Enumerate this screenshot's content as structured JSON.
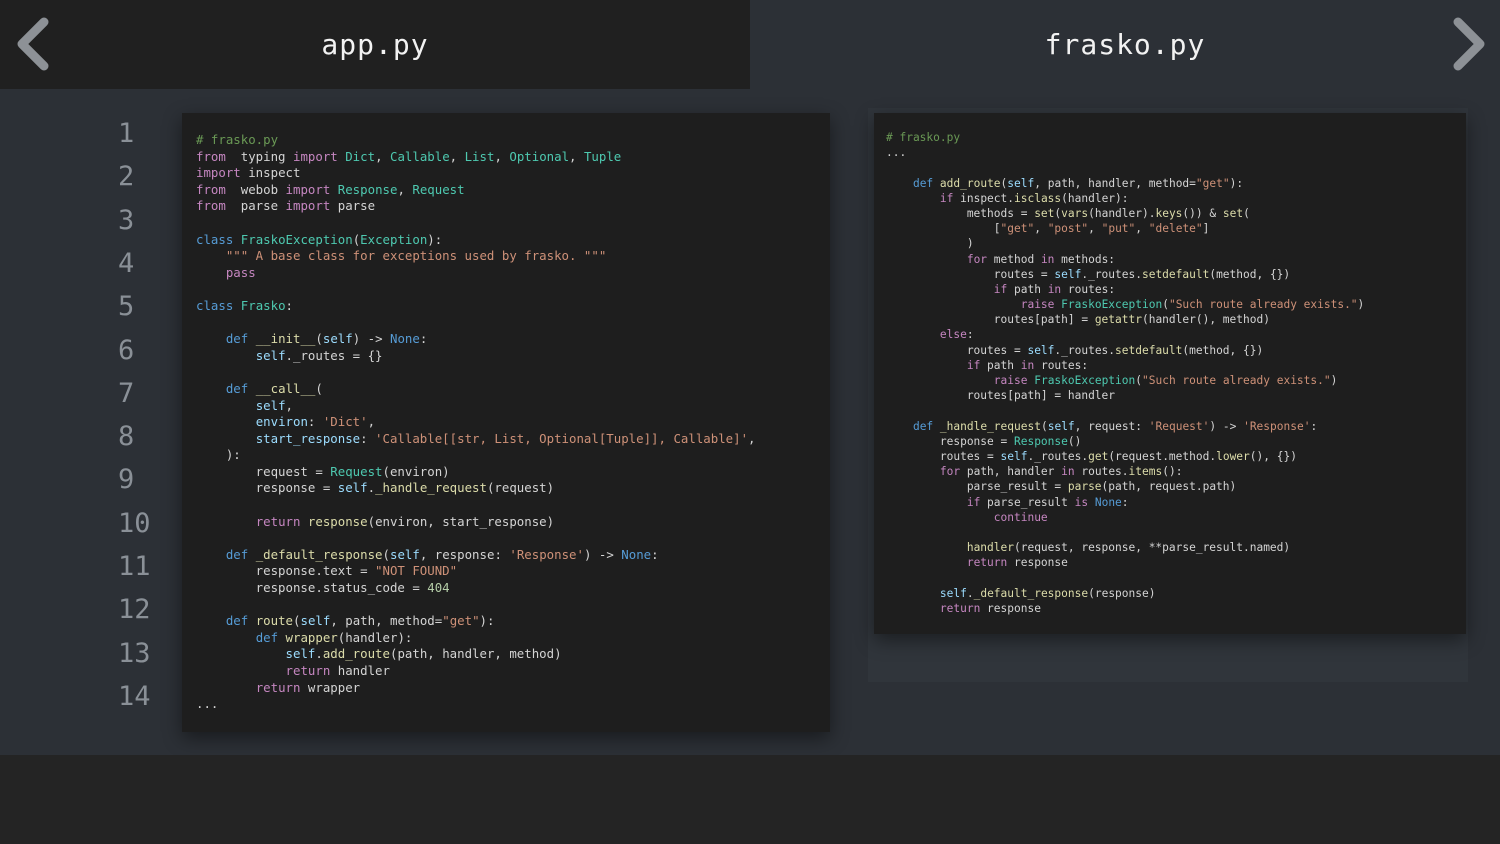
{
  "tabs": {
    "left": "app.py",
    "right": "frasko.py"
  },
  "nav": {
    "prev_icon": "chevron-left-icon",
    "next_icon": "chevron-right-icon"
  },
  "colors": {
    "chevron": "#8d9196",
    "editor_bg": "#1e1e1e",
    "page_bg": "#2c3036"
  },
  "line_numbers": [
    "1",
    "2",
    "3",
    "4",
    "5",
    "6",
    "7",
    "8",
    "9",
    "10",
    "11",
    "12",
    "13",
    "14"
  ],
  "code_left": [
    [
      [
        "c",
        "# frasko.py"
      ]
    ],
    [
      [
        "k",
        "from"
      ],
      [
        "",
        "  typing "
      ],
      [
        "k",
        "import"
      ],
      [
        "",
        "",
        " "
      ],
      [
        "t",
        "Dict"
      ],
      [
        "",
        ", "
      ],
      [
        "t",
        "Callable"
      ],
      [
        "",
        ", "
      ],
      [
        "t",
        "List"
      ],
      [
        "",
        ", "
      ],
      [
        "t",
        "Optional"
      ],
      [
        "",
        ", "
      ],
      [
        "t",
        "Tuple"
      ]
    ],
    [
      [
        "k",
        "import"
      ],
      [
        "",
        "",
        " inspect"
      ]
    ],
    [
      [
        "k",
        "from"
      ],
      [
        "",
        "  webob "
      ],
      [
        "k",
        "import"
      ],
      [
        "",
        "",
        " "
      ],
      [
        "t",
        "Response"
      ],
      [
        "",
        ", "
      ],
      [
        "t",
        "Request"
      ]
    ],
    [
      [
        "k",
        "from"
      ],
      [
        "",
        "  parse "
      ],
      [
        "k",
        "import"
      ],
      [
        "",
        "",
        " parse"
      ]
    ],
    [],
    [
      [
        "b",
        "class"
      ],
      [
        "",
        " "
      ],
      [
        "t",
        "FraskoException"
      ],
      [
        "",
        "("
      ],
      [
        "t",
        "Exception"
      ],
      [
        "",
        "):"
      ]
    ],
    [
      [
        "",
        ""
      ],
      [
        "",
        "    "
      ],
      [
        "s",
        "\"\"\" A base class for exceptions used by frasko. \"\"\""
      ]
    ],
    [
      [
        "",
        "    "
      ],
      [
        "k",
        "pass"
      ]
    ],
    [],
    [
      [
        "b",
        "class"
      ],
      [
        "",
        " "
      ],
      [
        "t",
        "Frasko"
      ],
      [
        "",
        ":"
      ]
    ],
    [],
    [
      [
        "",
        "    "
      ],
      [
        "b",
        "def"
      ],
      [
        "",
        " "
      ],
      [
        "f",
        "__init__"
      ],
      [
        "",
        "("
      ],
      [
        "v",
        "self"
      ],
      [
        "",
        ") -> "
      ],
      [
        "b",
        "None"
      ],
      [
        "",
        ":"
      ]
    ],
    [
      [
        "",
        "        "
      ],
      [
        "v",
        "self"
      ],
      [
        "",
        "._routes = {}"
      ]
    ],
    [],
    [
      [
        "",
        "    "
      ],
      [
        "b",
        "def"
      ],
      [
        "",
        " "
      ],
      [
        "f",
        "__call__"
      ],
      [
        "",
        "("
      ]
    ],
    [
      [
        "",
        "        "
      ],
      [
        "v",
        "self"
      ],
      [
        "",
        ","
      ]
    ],
    [
      [
        "",
        "        "
      ],
      [
        "v",
        "environ"
      ],
      [
        "",
        ": "
      ],
      [
        "s",
        "'Dict'"
      ],
      [
        "",
        ","
      ]
    ],
    [
      [
        "",
        "        "
      ],
      [
        "v",
        "start_response"
      ],
      [
        "",
        ": "
      ],
      [
        "s",
        "'Callable[[str, List, Optional[Tuple]], Callable]'"
      ],
      [
        "",
        ","
      ]
    ],
    [
      [
        "",
        "    ):"
      ]
    ],
    [
      [
        "",
        "        request = "
      ],
      [
        "t",
        "Request"
      ],
      [
        "",
        "(environ)"
      ]
    ],
    [
      [
        "",
        "        response = "
      ],
      [
        "v",
        "self"
      ],
      [
        "",
        "."
      ],
      [
        "f",
        "_handle_request"
      ],
      [
        "",
        "(request)"
      ]
    ],
    [],
    [
      [
        "",
        "        "
      ],
      [
        "k",
        "return"
      ],
      [
        "",
        " "
      ],
      [
        "f",
        "response"
      ],
      [
        "",
        "(environ, start_response)"
      ]
    ],
    [],
    [
      [
        "",
        "    "
      ],
      [
        "b",
        "def"
      ],
      [
        "",
        " "
      ],
      [
        "f",
        "_default_response"
      ],
      [
        "",
        "("
      ],
      [
        "v",
        "self"
      ],
      [
        "",
        ", response: "
      ],
      [
        "s",
        "'Response'"
      ],
      [
        "",
        ") -> "
      ],
      [
        "b",
        "None"
      ],
      [
        "",
        ":"
      ]
    ],
    [
      [
        "",
        "        response.text = "
      ],
      [
        "s",
        "\"NOT FOUND\""
      ]
    ],
    [
      [
        "",
        "        response.status_code = "
      ],
      [
        "n",
        "404"
      ]
    ],
    [],
    [
      [
        "",
        "    "
      ],
      [
        "b",
        "def"
      ],
      [
        "",
        " "
      ],
      [
        "f",
        "route"
      ],
      [
        "",
        "("
      ],
      [
        "v",
        "self"
      ],
      [
        "",
        ", path, method="
      ],
      [
        "s",
        "\"get\""
      ],
      [
        "",
        "):"
      ]
    ],
    [
      [
        "",
        "        "
      ],
      [
        "b",
        "def"
      ],
      [
        "",
        " "
      ],
      [
        "f",
        "wrapper"
      ],
      [
        "",
        "(handler):"
      ]
    ],
    [
      [
        "",
        "            "
      ],
      [
        "v",
        "self"
      ],
      [
        "",
        "."
      ],
      [
        "f",
        "add_route"
      ],
      [
        "",
        "(path, handler, method)"
      ]
    ],
    [
      [
        "",
        "            "
      ],
      [
        "k",
        "return"
      ],
      [
        "",
        " handler"
      ]
    ],
    [
      [
        "",
        "        "
      ],
      [
        "k",
        "return"
      ],
      [
        "",
        " wrapper"
      ]
    ],
    [
      [
        "",
        "..."
      ]
    ]
  ],
  "code_right": [
    [
      [
        "c",
        "# frasko.py"
      ]
    ],
    [
      [
        "",
        "..."
      ]
    ],
    [],
    [
      [
        "",
        "    "
      ],
      [
        "b",
        "def"
      ],
      [
        "",
        " "
      ],
      [
        "f",
        "add_route"
      ],
      [
        "",
        "("
      ],
      [
        "v",
        "self"
      ],
      [
        "",
        ", path, handler, method="
      ],
      [
        "s",
        "\"get\""
      ],
      [
        "",
        "):"
      ]
    ],
    [
      [
        "",
        "        "
      ],
      [
        "k",
        "if"
      ],
      [
        "",
        " inspect."
      ],
      [
        "f",
        "isclass"
      ],
      [
        "",
        "(handler):"
      ]
    ],
    [
      [
        "",
        "            methods = "
      ],
      [
        "f",
        "set"
      ],
      [
        "",
        "("
      ],
      [
        "f",
        "vars"
      ],
      [
        "",
        "(handler)."
      ],
      [
        "f",
        "keys"
      ],
      [
        "",
        "()) & "
      ],
      [
        "f",
        "set"
      ],
      [
        "",
        "("
      ]
    ],
    [
      [
        "",
        "                ["
      ],
      [
        "s",
        "\"get\""
      ],
      [
        "",
        ", "
      ],
      [
        "s",
        "\"post\""
      ],
      [
        "",
        ", "
      ],
      [
        "s",
        "\"put\""
      ],
      [
        "",
        ", "
      ],
      [
        "s",
        "\"delete\""
      ],
      [
        "",
        "]"
      ]
    ],
    [
      [
        "",
        "            )"
      ]
    ],
    [
      [
        "",
        "            "
      ],
      [
        "k",
        "for"
      ],
      [
        "",
        " method "
      ],
      [
        "k",
        "in"
      ],
      [
        "",
        " methods:"
      ]
    ],
    [
      [
        "",
        "                routes = "
      ],
      [
        "v",
        "self"
      ],
      [
        "",
        "._routes."
      ],
      [
        "f",
        "setdefault"
      ],
      [
        "",
        "(method, {})"
      ]
    ],
    [
      [
        "",
        "                "
      ],
      [
        "k",
        "if"
      ],
      [
        "",
        " path "
      ],
      [
        "k",
        "in"
      ],
      [
        "",
        " routes:"
      ]
    ],
    [
      [
        "",
        "                    "
      ],
      [
        "k",
        "raise"
      ],
      [
        "",
        " "
      ],
      [
        "t",
        "FraskoException"
      ],
      [
        "",
        "("
      ],
      [
        "s",
        "\"Such route already exists.\""
      ],
      [
        "",
        ")"
      ]
    ],
    [
      [
        "",
        "                routes[path] = "
      ],
      [
        "f",
        "getattr"
      ],
      [
        "",
        "(handler(), method)"
      ]
    ],
    [
      [
        "",
        "        "
      ],
      [
        "k",
        "else"
      ],
      [
        "",
        ":"
      ]
    ],
    [
      [
        "",
        "            routes = "
      ],
      [
        "v",
        "self"
      ],
      [
        "",
        "._routes."
      ],
      [
        "f",
        "setdefault"
      ],
      [
        "",
        "(method, {})"
      ]
    ],
    [
      [
        "",
        "            "
      ],
      [
        "k",
        "if"
      ],
      [
        "",
        " path "
      ],
      [
        "k",
        "in"
      ],
      [
        "",
        " routes:"
      ]
    ],
    [
      [
        "",
        "                "
      ],
      [
        "k",
        "raise"
      ],
      [
        "",
        " "
      ],
      [
        "t",
        "FraskoException"
      ],
      [
        "",
        "("
      ],
      [
        "s",
        "\"Such route already exists.\""
      ],
      [
        "",
        ")"
      ]
    ],
    [
      [
        "",
        "            routes[path] = handler"
      ]
    ],
    [],
    [
      [
        "",
        "    "
      ],
      [
        "b",
        "def"
      ],
      [
        "",
        " "
      ],
      [
        "f",
        "_handle_request"
      ],
      [
        "",
        "("
      ],
      [
        "v",
        "self"
      ],
      [
        "",
        ", request: "
      ],
      [
        "s",
        "'Request'"
      ],
      [
        "",
        ") -> "
      ],
      [
        "s",
        "'Response'"
      ],
      [
        "",
        ":"
      ]
    ],
    [
      [
        "",
        "        response = "
      ],
      [
        "t",
        "Response"
      ],
      [
        "",
        "()"
      ]
    ],
    [
      [
        "",
        "        routes = "
      ],
      [
        "v",
        "self"
      ],
      [
        "",
        "._routes."
      ],
      [
        "f",
        "get"
      ],
      [
        "",
        "(request.method."
      ],
      [
        "f",
        "lower"
      ],
      [
        "",
        "(), {})"
      ]
    ],
    [
      [
        "",
        "        "
      ],
      [
        "k",
        "for"
      ],
      [
        "",
        " path, handler "
      ],
      [
        "k",
        "in"
      ],
      [
        "",
        " routes."
      ],
      [
        "f",
        "items"
      ],
      [
        "",
        "():"
      ]
    ],
    [
      [
        "",
        "            parse_result = "
      ],
      [
        "f",
        "parse"
      ],
      [
        "",
        "(path, request.path)"
      ]
    ],
    [
      [
        "",
        "            "
      ],
      [
        "k",
        "if"
      ],
      [
        "",
        " parse_result "
      ],
      [
        "k",
        "is"
      ],
      [
        "",
        " "
      ],
      [
        "b",
        "None"
      ],
      [
        "",
        ":"
      ]
    ],
    [
      [
        "",
        "                "
      ],
      [
        "k",
        "continue"
      ]
    ],
    [],
    [
      [
        "",
        "            "
      ],
      [
        "f",
        "handler"
      ],
      [
        "",
        "(request, response, **parse_result.named)"
      ]
    ],
    [
      [
        "",
        "            "
      ],
      [
        "k",
        "return"
      ],
      [
        "",
        " response"
      ]
    ],
    [],
    [
      [
        "",
        "        "
      ],
      [
        "v",
        "self"
      ],
      [
        "",
        "."
      ],
      [
        "f",
        "_default_response"
      ],
      [
        "",
        "(response)"
      ]
    ],
    [
      [
        "",
        "        "
      ],
      [
        "k",
        "return"
      ],
      [
        "",
        " response"
      ]
    ]
  ]
}
